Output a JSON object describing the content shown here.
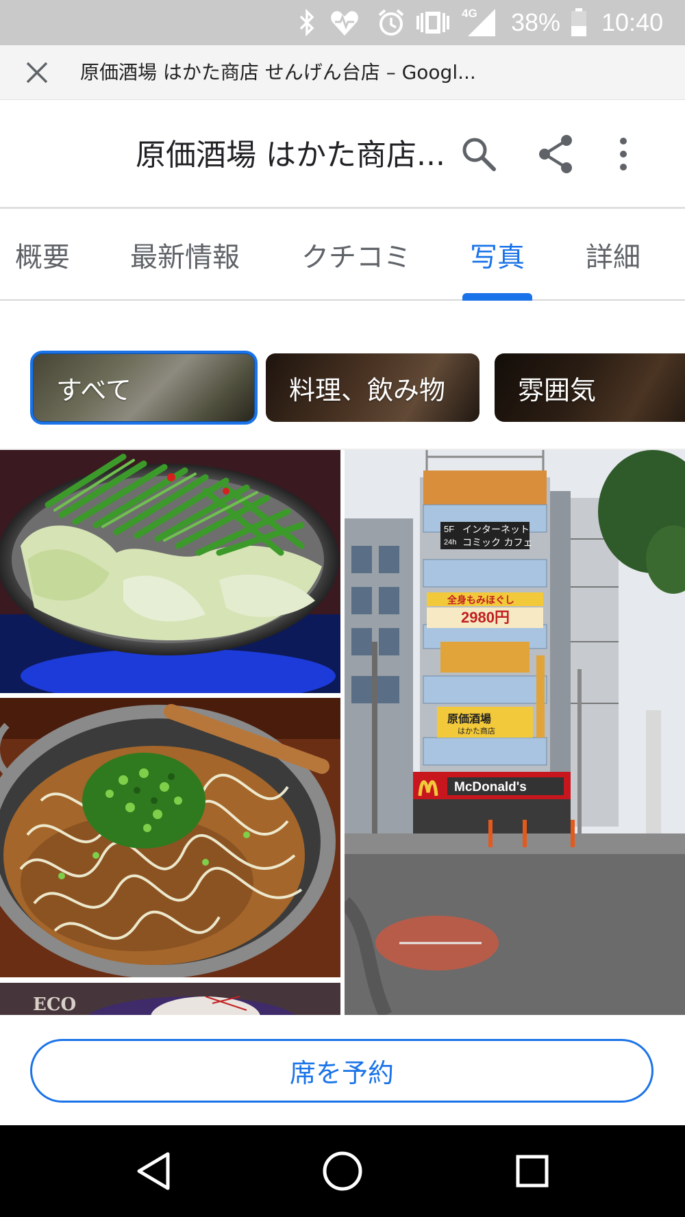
{
  "status_bar": {
    "battery": "38%",
    "time": "10:40",
    "network": "4G",
    "icons": [
      "bluetooth-icon",
      "heart-monitor-icon",
      "alarm-icon",
      "vibrate-icon",
      "signal-icon",
      "battery-icon"
    ]
  },
  "url_bar": {
    "title": "原価酒場 はかた商店 せんげん台店 – Googl..."
  },
  "app_bar": {
    "place_name": "原価酒場 はかた商店..."
  },
  "tabs": [
    {
      "label": "概要",
      "active": false
    },
    {
      "label": "最新情報",
      "active": false
    },
    {
      "label": "クチコミ",
      "active": false
    },
    {
      "label": "写真",
      "active": true
    },
    {
      "label": "詳細",
      "active": false
    }
  ],
  "filter_chips": [
    {
      "label": "すべて",
      "selected": true
    },
    {
      "label": "料理、飲み物",
      "selected": false
    },
    {
      "label": "雰囲気",
      "selected": false
    }
  ],
  "photos": {
    "building_signs": {
      "sign_5f": "5F",
      "sign_24h": "24h",
      "sign_internet": "インターネット",
      "sign_comic": "コミック カフェ",
      "sign_massage": "全身もみほぐし",
      "sign_price": "2980円",
      "sign_izakaya": "原価酒場",
      "sign_hakata": "はかた商店",
      "sign_mcd": "McDonald's"
    }
  },
  "actions": {
    "reserve_label": "席を予約"
  },
  "colors": {
    "accent": "#1a73e8",
    "status_bar": "#c9c9c9",
    "nav_bar": "#000000"
  }
}
